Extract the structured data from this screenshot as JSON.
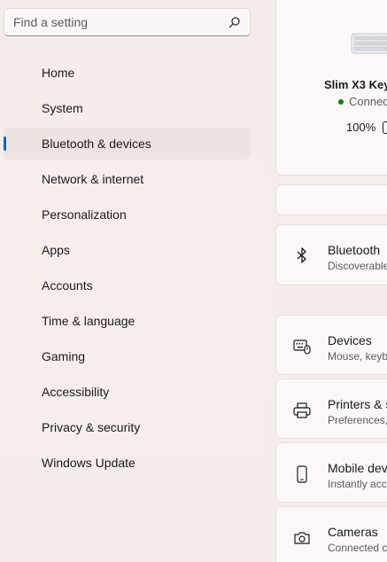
{
  "search": {
    "placeholder": "Find a setting"
  },
  "nav": {
    "items": [
      {
        "label": "Home"
      },
      {
        "label": "System"
      },
      {
        "label": "Bluetooth & devices"
      },
      {
        "label": "Network & internet"
      },
      {
        "label": "Personalization"
      },
      {
        "label": "Apps"
      },
      {
        "label": "Accounts"
      },
      {
        "label": "Time & language"
      },
      {
        "label": "Gaming"
      },
      {
        "label": "Accessibility"
      },
      {
        "label": "Privacy & security"
      },
      {
        "label": "Windows Update"
      }
    ],
    "active": "Bluetooth & devices"
  },
  "device": {
    "name": "Slim X3 Key",
    "status": "Connec",
    "battery": "100%"
  },
  "rows": [
    {
      "title": "Bluetooth",
      "subtitle": "Discoverable",
      "icon": "bluetooth-icon"
    },
    {
      "title": "Devices",
      "subtitle": "Mouse, keyb",
      "icon": "devices-icon"
    },
    {
      "title": "Printers & s",
      "subtitle": "Preferences,",
      "icon": "printer-icon"
    },
    {
      "title": "Mobile dev",
      "subtitle": "Instantly acc",
      "icon": "phone-icon"
    },
    {
      "title": "Cameras",
      "subtitle": "Connected c",
      "icon": "camera-icon"
    }
  ],
  "colors": {
    "accent": "#0067c0",
    "connected": "#0f7b0f"
  }
}
